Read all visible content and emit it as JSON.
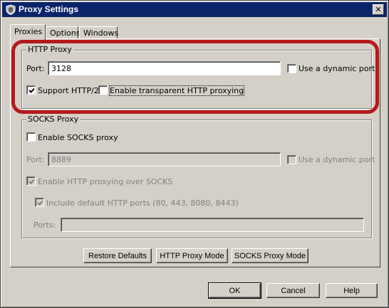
{
  "window": {
    "title": "Proxy Settings",
    "close_label": "✕"
  },
  "tabs": [
    {
      "label": "Proxies",
      "active": true
    },
    {
      "label": "Options",
      "active": false
    },
    {
      "label": "Windows",
      "active": false
    }
  ],
  "http_proxy": {
    "group_label": "HTTP Proxy",
    "port_label": "Port:",
    "port_value": "3128",
    "dynamic_port_label": "Use a dynamic port",
    "dynamic_port_checked": false,
    "support_http2_label": "Support HTTP/2",
    "support_http2_checked": true,
    "transparent_label": "Enable transparent HTTP proxying",
    "transparent_checked": false
  },
  "socks_proxy": {
    "group_label": "SOCKS Proxy",
    "enable_label": "Enable SOCKS proxy",
    "enable_checked": false,
    "port_label": "Port:",
    "port_value": "8889",
    "dynamic_port_label": "Use a dynamic port",
    "http_over_socks_label": "Enable HTTP proxying over SOCKS",
    "http_over_socks_checked": true,
    "include_default_ports_label": "Include default HTTP ports (80, 443, 8080, 8443)",
    "include_default_ports_checked": true,
    "ports_label": "Ports:",
    "ports_value": ""
  },
  "panel_buttons": {
    "restore_defaults": "Restore Defaults",
    "http_proxy_mode": "HTTP Proxy Mode",
    "socks_proxy_mode": "SOCKS Proxy Mode"
  },
  "dialog_buttons": {
    "ok": "OK",
    "cancel": "Cancel",
    "help": "Help"
  },
  "colors": {
    "titlebar": "#0a246a",
    "highlight": "#b5191c",
    "face": "#d4d0c8"
  }
}
